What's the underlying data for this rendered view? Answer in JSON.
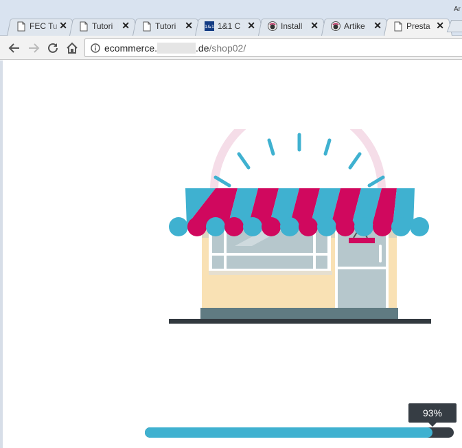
{
  "window": {
    "corner_text": "Ar"
  },
  "tabs": [
    {
      "title": "FEC Tu",
      "favicon": "page-icon",
      "active": false
    },
    {
      "title": "Tutori",
      "favicon": "page-icon",
      "active": false
    },
    {
      "title": "Tutori",
      "favicon": "page-icon",
      "active": false
    },
    {
      "title": "1&1 C",
      "favicon": "1and1-icon",
      "active": false
    },
    {
      "title": "Install",
      "favicon": "prestashop-icon",
      "active": false
    },
    {
      "title": "Artike",
      "favicon": "prestashop-icon",
      "active": false
    },
    {
      "title": "Presta",
      "favicon": "page-icon",
      "active": true
    }
  ],
  "toolbar": {
    "back": "back-arrow-icon",
    "forward": "forward-arrow-icon",
    "reload": "reload-icon",
    "home": "home-icon"
  },
  "address": {
    "prefix": "ecommerce.",
    "domain_suffix": ".de",
    "path": "/shop02/"
  },
  "progress": {
    "label": "93%",
    "fraction": 0.93
  },
  "colors": {
    "accent": "#3fb1d0",
    "awning_red": "#d0085e",
    "track": "#363d44",
    "wall": "#f9e1b4",
    "glass": "#b6c7cc"
  }
}
